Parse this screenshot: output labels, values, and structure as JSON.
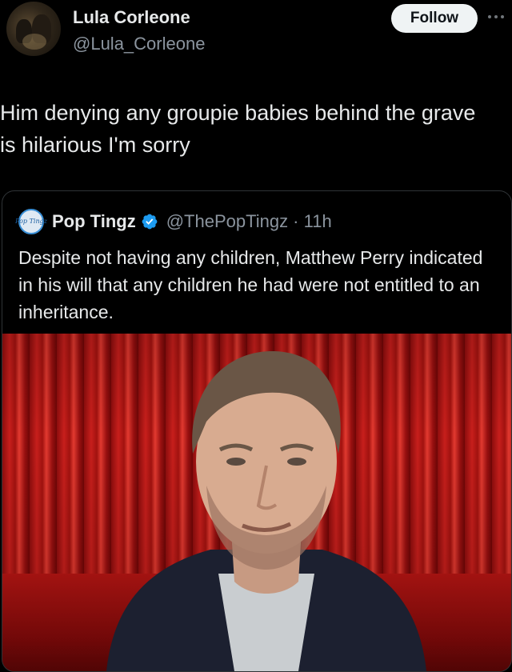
{
  "post": {
    "display_name": "Lula Corleone",
    "handle": "@Lula_Corleone",
    "follow_label": "Follow",
    "text": "Him denying any groupie babies behind the grave is hilarious I'm sorry"
  },
  "quoted": {
    "avatar_text": "Pop Tingz",
    "display_name": "Pop Tingz",
    "handle_time": "@ThePopTingz · 11h",
    "verified": true,
    "text": "Despite not having any children, Matthew Perry indicated in his will that any children he had were not entitled to an inheritance."
  },
  "icons": {
    "more": "more-horizontal-icon",
    "verified": "verified-badge-icon"
  },
  "colors": {
    "background": "#000000",
    "text_primary": "#e7e9ea",
    "text_secondary": "#8b949e",
    "verified_blue": "#1d9bf0",
    "follow_bg": "#eff3f4"
  }
}
